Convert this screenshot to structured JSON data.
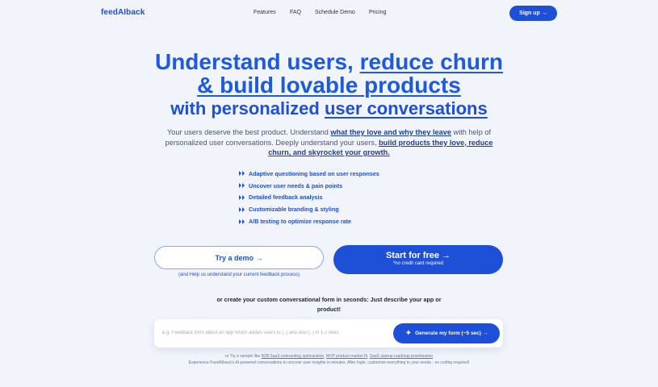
{
  "nav": {
    "brand": "feedAIback",
    "links": [
      "Features",
      "FAQ",
      "Schedule Demo",
      "Pricing"
    ],
    "signup": "Sign up",
    "signup_arrow": "→"
  },
  "hero": {
    "line1_plain": "Understand users, ",
    "line1_link": "reduce churn",
    "line2_link": "& build lovable products",
    "line3_plain": "with personalized ",
    "line3_link": "user conversations"
  },
  "description": {
    "p1": "Your users deserve the best product. Understand ",
    "b1": "what they love and why they leave",
    "p2": " with help of personalized user conversations. Deeply understand your users, ",
    "b2": "build products they love, reduce churn, and skyrocket your growth."
  },
  "features": [
    "Adaptive questioning based on user responses",
    "Uncover user needs & pain points",
    "Detailed feedback analysis",
    "Customizable branding & styling",
    "A/B testing to optimize response rate"
  ],
  "cta": {
    "demo_label": "Try a demo →",
    "demo_note": "(and Help us understand your current feedback process)",
    "start_label": "Start for free →",
    "start_sub": "*no credit card required"
  },
  "create": {
    "prompt": "or create your custom conversational form in seconds: Just describe your app or product!",
    "placeholder": "e.g. Feedback form about an app which allows users to [..] and also [..] in 1-2 lines",
    "generate_label": "Generate my form (~5 sec) →",
    "samples_prefix": "or Try a sample like ",
    "samples": [
      "B2B SaaS onboarding optimization",
      "MVP product-market fit",
      "SaaS startup roadmap prioritization"
    ],
    "experience": "Experience FeedAIback's AI-powered conversations to uncover user insights in minutes. After login, customize everything to your needs - no coding required!"
  }
}
